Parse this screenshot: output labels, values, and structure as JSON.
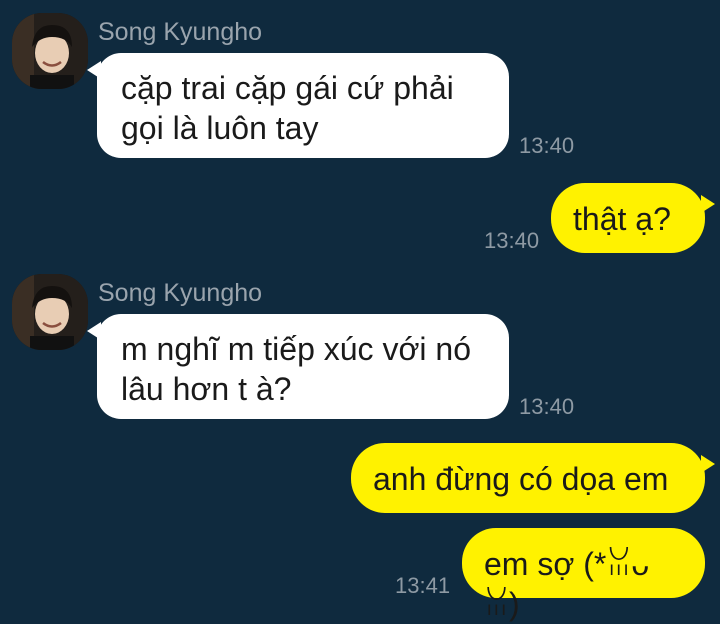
{
  "messages": [
    {
      "sender": "Song Kyungho",
      "text": "cặp trai cặp gái cứ phải\ngọi là luôn tay",
      "time": "13:40"
    },
    {
      "text": "thật ạ?",
      "time": "13:40"
    },
    {
      "sender": "Song Kyungho",
      "text": "m nghĩ m tiếp xúc với nó\nlâu hơn t à?",
      "time": "13:40"
    },
    {
      "text": "anh đừng có dọa em"
    },
    {
      "text": "em sợ (*ꈍᴗꈍ)",
      "time": "13:41"
    }
  ],
  "colors": {
    "background": "#0f2a3e",
    "incoming_bubble": "#ffffff",
    "outgoing_bubble": "#fff200",
    "sender_name": "#9aa4ad",
    "timestamp": "#8e9aa4"
  },
  "icons": {
    "avatar": "profile-photo-avatar"
  }
}
